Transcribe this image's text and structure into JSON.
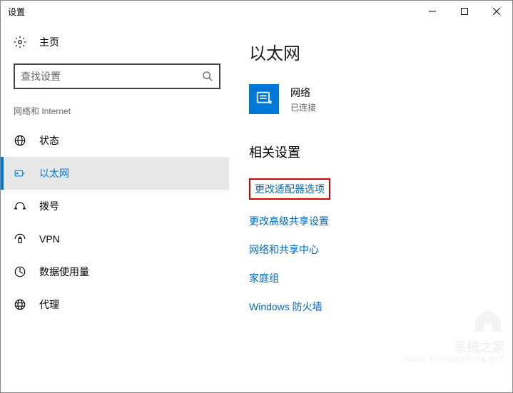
{
  "window": {
    "title": "设置"
  },
  "sidebar": {
    "home_label": "主页",
    "search_placeholder": "查找设置",
    "category": "网络和 Internet",
    "items": [
      {
        "label": "状态",
        "icon": "globe"
      },
      {
        "label": "以太网",
        "icon": "ethernet"
      },
      {
        "label": "拨号",
        "icon": "dialup"
      },
      {
        "label": "VPN",
        "icon": "vpn"
      },
      {
        "label": "数据使用量",
        "icon": "data"
      },
      {
        "label": "代理",
        "icon": "proxy"
      }
    ],
    "active_index": 1
  },
  "main": {
    "title": "以太网",
    "network": {
      "name": "网络",
      "status": "已连接"
    },
    "related_section": "相关设置",
    "links": [
      "更改适配器选项",
      "更改高级共享设置",
      "网络和共享中心",
      "家庭组",
      "Windows 防火墙"
    ],
    "highlighted_link_index": 0
  }
}
